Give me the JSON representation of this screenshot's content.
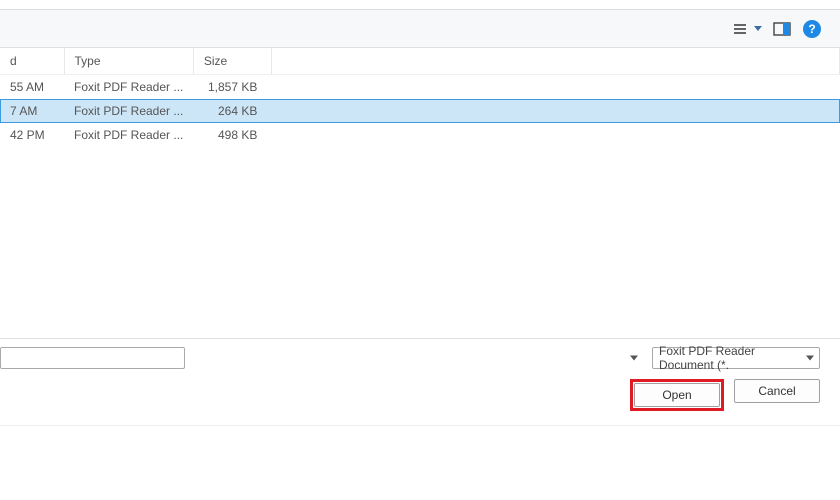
{
  "toolbar": {
    "view_menu_title": "View options",
    "preview_title": "Preview pane",
    "help_glyph": "?"
  },
  "columns": {
    "date": "d",
    "type": "Type",
    "size": "Size"
  },
  "rows": [
    {
      "date": "55 AM",
      "type": "Foxit PDF Reader ...",
      "size": "1,857 KB",
      "selected": false
    },
    {
      "date": "7 AM",
      "type": "Foxit PDF Reader ...",
      "size": "264 KB",
      "selected": true
    },
    {
      "date": "42 PM",
      "type": "Foxit PDF Reader ...",
      "size": "498 KB",
      "selected": false
    }
  ],
  "filename": {
    "value": ""
  },
  "filetype": {
    "label": "Foxit PDF Reader Document (*."
  },
  "buttons": {
    "open": "Open",
    "cancel": "Cancel"
  }
}
